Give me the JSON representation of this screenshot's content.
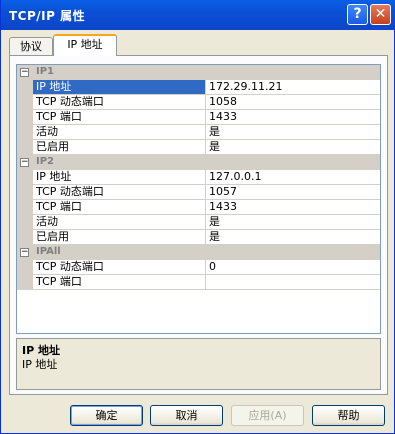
{
  "window": {
    "title": "TCP/IP 属性",
    "help_glyph": "?",
    "close_glyph": "✕"
  },
  "tabs": [
    {
      "label": "协议",
      "active": false
    },
    {
      "label": "IP 地址",
      "active": true
    }
  ],
  "grid": {
    "expand_glyph": "−",
    "categories": [
      {
        "name": "IP1",
        "rows": [
          {
            "name": "IP 地址",
            "value": "172.29.11.21",
            "selected": true
          },
          {
            "name": "TCP 动态端口",
            "value": "1058"
          },
          {
            "name": "TCP 端口",
            "value": "1433"
          },
          {
            "name": "活动",
            "value": "是"
          },
          {
            "name": "已启用",
            "value": "是"
          }
        ]
      },
      {
        "name": "IP2",
        "rows": [
          {
            "name": "IP 地址",
            "value": "127.0.0.1"
          },
          {
            "name": "TCP 动态端口",
            "value": "1057"
          },
          {
            "name": "TCP 端口",
            "value": "1433"
          },
          {
            "name": "活动",
            "value": "是"
          },
          {
            "name": "已启用",
            "value": "是"
          }
        ]
      },
      {
        "name": "IPAll",
        "rows": [
          {
            "name": "TCP 动态端口",
            "value": "0"
          },
          {
            "name": "TCP 端口",
            "value": ""
          }
        ]
      }
    ]
  },
  "description": {
    "title": "IP 地址",
    "text": "IP 地址"
  },
  "buttons": {
    "ok": "确定",
    "cancel": "取消",
    "apply": "应用(A)",
    "help": "帮助"
  }
}
